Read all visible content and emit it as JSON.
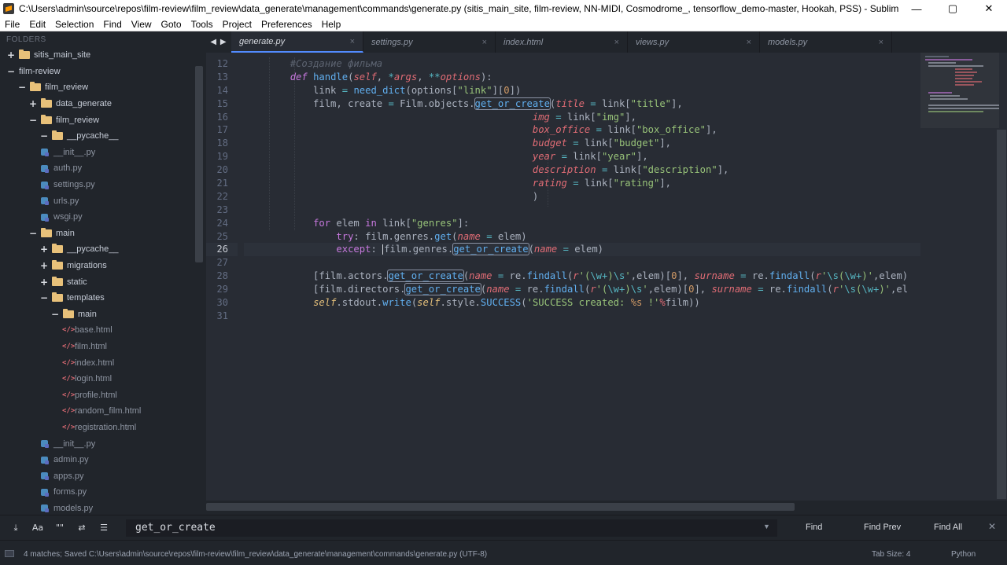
{
  "window": {
    "title": "C:\\Users\\admin\\source\\repos\\film-review\\film_review\\data_generate\\management\\commands\\generate.py (sitis_main_site, film-review, NN-MIDI, Cosmodrome_, tensorflow_demo-master, Hookah, PSS) - Sublime Text",
    "minimize": "—",
    "maximize": "▢",
    "close": "✕"
  },
  "menu": [
    "File",
    "Edit",
    "Selection",
    "Find",
    "View",
    "Goto",
    "Tools",
    "Project",
    "Preferences",
    "Help"
  ],
  "sidebar": {
    "header": "FOLDERS",
    "items": [
      {
        "depth": 0,
        "type": "folder",
        "ctrl": "+",
        "label": "sitis_main_site"
      },
      {
        "depth": 0,
        "type": "root",
        "ctrl": "−",
        "label": "film-review"
      },
      {
        "depth": 1,
        "type": "folder",
        "ctrl": "−",
        "label": "film_review"
      },
      {
        "depth": 2,
        "type": "folder",
        "ctrl": "+",
        "label": "data_generate"
      },
      {
        "depth": 2,
        "type": "folder",
        "ctrl": "−",
        "label": "film_review"
      },
      {
        "depth": 3,
        "type": "folder",
        "ctrl": "−",
        "label": "__pycache__"
      },
      {
        "depth": 3,
        "type": "py",
        "label": "__init__.py"
      },
      {
        "depth": 3,
        "type": "py",
        "label": "auth.py"
      },
      {
        "depth": 3,
        "type": "py",
        "label": "settings.py"
      },
      {
        "depth": 3,
        "type": "py",
        "label": "urls.py"
      },
      {
        "depth": 3,
        "type": "py",
        "label": "wsgi.py"
      },
      {
        "depth": 2,
        "type": "folder",
        "ctrl": "−",
        "label": "main"
      },
      {
        "depth": 3,
        "type": "folder",
        "ctrl": "+",
        "label": "__pycache__"
      },
      {
        "depth": 3,
        "type": "folder",
        "ctrl": "+",
        "label": "migrations"
      },
      {
        "depth": 3,
        "type": "folder",
        "ctrl": "+",
        "label": "static"
      },
      {
        "depth": 3,
        "type": "folder",
        "ctrl": "−",
        "label": "templates"
      },
      {
        "depth": 4,
        "type": "folder",
        "ctrl": "−",
        "label": "main"
      },
      {
        "depth": 5,
        "type": "html",
        "label": "base.html"
      },
      {
        "depth": 5,
        "type": "html",
        "label": "film.html"
      },
      {
        "depth": 5,
        "type": "html",
        "label": "index.html"
      },
      {
        "depth": 5,
        "type": "html",
        "label": "login.html"
      },
      {
        "depth": 5,
        "type": "html",
        "label": "profile.html"
      },
      {
        "depth": 5,
        "type": "html",
        "label": "random_film.html"
      },
      {
        "depth": 5,
        "type": "html",
        "label": "registration.html"
      },
      {
        "depth": 3,
        "type": "py",
        "label": "__init__.py"
      },
      {
        "depth": 3,
        "type": "py",
        "label": "admin.py"
      },
      {
        "depth": 3,
        "type": "py",
        "label": "apps.py"
      },
      {
        "depth": 3,
        "type": "py",
        "label": "forms.py"
      },
      {
        "depth": 3,
        "type": "py",
        "label": "models.py"
      }
    ]
  },
  "tabs": {
    "nav": "◀ ▶",
    "items": [
      {
        "label": "generate.py",
        "active": true
      },
      {
        "label": "settings.py",
        "active": false
      },
      {
        "label": "index.html",
        "active": false
      },
      {
        "label": "views.py",
        "active": false
      },
      {
        "label": "models.py",
        "active": false
      }
    ]
  },
  "editor": {
    "active_line": 26,
    "lines": [
      {
        "n": "12",
        "tokens": [
          [
            "",
            "        "
          ],
          [
            "cm",
            "#Создание фильма"
          ]
        ]
      },
      {
        "n": "13",
        "tokens": [
          [
            "",
            "        "
          ],
          [
            "ki",
            "def"
          ],
          [
            "",
            " "
          ],
          [
            "fn",
            "handle"
          ],
          [
            "",
            "("
          ],
          [
            "par",
            "self"
          ],
          [
            "",
            ", "
          ],
          [
            "op",
            "*"
          ],
          [
            "par",
            "args"
          ],
          [
            "",
            ", "
          ],
          [
            "op",
            "**"
          ],
          [
            "par",
            "options"
          ],
          [
            "",
            "):"
          ]
        ]
      },
      {
        "n": "14",
        "tokens": [
          [
            "",
            "            link "
          ],
          [
            "op",
            "="
          ],
          [
            "",
            " "
          ],
          [
            "fn",
            "need_dict"
          ],
          [
            "",
            "(options["
          ],
          [
            "str",
            "\"link\""
          ],
          [
            "",
            "]["
          ],
          [
            "num",
            "0"
          ],
          [
            "",
            "])"
          ]
        ]
      },
      {
        "n": "15",
        "tokens": [
          [
            "",
            "            film, create "
          ],
          [
            "op",
            "="
          ],
          [
            "",
            " Film.objects."
          ],
          [
            "hl",
            "get_or_create"
          ],
          [
            "",
            "("
          ],
          [
            "par",
            "title"
          ],
          [
            "",
            " "
          ],
          [
            "op",
            "="
          ],
          [
            "",
            " link["
          ],
          [
            "str",
            "\"title\""
          ],
          [
            "",
            "],"
          ]
        ]
      },
      {
        "n": "16",
        "tokens": [
          [
            "",
            "                                                  "
          ],
          [
            "par",
            "img"
          ],
          [
            "",
            " "
          ],
          [
            "op",
            "="
          ],
          [
            "",
            " link["
          ],
          [
            "str",
            "\"img\""
          ],
          [
            "",
            "],"
          ]
        ]
      },
      {
        "n": "17",
        "tokens": [
          [
            "",
            "                                                  "
          ],
          [
            "par",
            "box_office"
          ],
          [
            "",
            " "
          ],
          [
            "op",
            "="
          ],
          [
            "",
            " link["
          ],
          [
            "str",
            "\"box_office\""
          ],
          [
            "",
            "],"
          ]
        ]
      },
      {
        "n": "18",
        "tokens": [
          [
            "",
            "                                                  "
          ],
          [
            "par",
            "budget"
          ],
          [
            "",
            " "
          ],
          [
            "op",
            "="
          ],
          [
            "",
            " link["
          ],
          [
            "str",
            "\"budget\""
          ],
          [
            "",
            "],"
          ]
        ]
      },
      {
        "n": "19",
        "tokens": [
          [
            "",
            "                                                  "
          ],
          [
            "par",
            "year"
          ],
          [
            "",
            " "
          ],
          [
            "op",
            "="
          ],
          [
            "",
            " link["
          ],
          [
            "str",
            "\"year\""
          ],
          [
            "",
            "],"
          ]
        ]
      },
      {
        "n": "20",
        "tokens": [
          [
            "",
            "                                                  "
          ],
          [
            "par",
            "description"
          ],
          [
            "",
            " "
          ],
          [
            "op",
            "="
          ],
          [
            "",
            " link["
          ],
          [
            "str",
            "\"description\""
          ],
          [
            "",
            "],"
          ]
        ]
      },
      {
        "n": "21",
        "tokens": [
          [
            "",
            "                                                  "
          ],
          [
            "par",
            "rating"
          ],
          [
            "",
            " "
          ],
          [
            "op",
            "="
          ],
          [
            "",
            " link["
          ],
          [
            "str",
            "\"rating\""
          ],
          [
            "",
            "],"
          ]
        ]
      },
      {
        "n": "22",
        "tokens": [
          [
            "",
            "                                                  )"
          ]
        ]
      },
      {
        "n": "23",
        "tokens": [
          [
            "",
            ""
          ]
        ]
      },
      {
        "n": "24",
        "tokens": [
          [
            "",
            "            "
          ],
          [
            "kw",
            "for"
          ],
          [
            "",
            " elem "
          ],
          [
            "kw",
            "in"
          ],
          [
            "",
            " link["
          ],
          [
            "str",
            "\"genres\""
          ],
          [
            "",
            "]:"
          ]
        ]
      },
      {
        "n": "25",
        "tokens": [
          [
            "",
            "                "
          ],
          [
            "kw",
            "try"
          ],
          [
            "",
            ": film.genres."
          ],
          [
            "fn",
            "get"
          ],
          [
            "",
            "("
          ],
          [
            "par",
            "name"
          ],
          [
            "",
            " "
          ],
          [
            "op",
            "="
          ],
          [
            "",
            " elem)"
          ]
        ]
      },
      {
        "n": "26",
        "tokens": [
          [
            "",
            "                "
          ],
          [
            "kw",
            "except"
          ],
          [
            "",
            ": "
          ],
          [
            "caret",
            ""
          ],
          [
            "",
            "film.genres."
          ],
          [
            "hl",
            "get_or_create"
          ],
          [
            "",
            "("
          ],
          [
            "par",
            "name"
          ],
          [
            "",
            " "
          ],
          [
            "op",
            "="
          ],
          [
            "",
            " elem)"
          ]
        ]
      },
      {
        "n": "27",
        "tokens": [
          [
            "",
            ""
          ]
        ]
      },
      {
        "n": "28",
        "tokens": [
          [
            "",
            "            [film.actors."
          ],
          [
            "hl",
            "get_or_create"
          ],
          [
            "",
            "("
          ],
          [
            "par",
            "name"
          ],
          [
            "",
            " "
          ],
          [
            "op",
            "="
          ],
          [
            "",
            " re."
          ],
          [
            "fn",
            "findall"
          ],
          [
            "",
            "("
          ],
          [
            "par",
            "r"
          ],
          [
            "str",
            "'("
          ],
          [
            "op",
            "\\w+"
          ],
          [
            "str",
            ")"
          ],
          [
            "op",
            "\\s"
          ],
          [
            "str",
            "'"
          ],
          [
            "",
            ",elem)["
          ],
          [
            "num",
            "0"
          ],
          [
            "",
            "], "
          ],
          [
            "par",
            "surname"
          ],
          [
            "",
            " "
          ],
          [
            "op",
            "="
          ],
          [
            "",
            " re."
          ],
          [
            "fn",
            "findall"
          ],
          [
            "",
            "("
          ],
          [
            "par",
            "r"
          ],
          [
            "str",
            "'"
          ],
          [
            "op",
            "\\s"
          ],
          [
            "str",
            "("
          ],
          [
            "op",
            "\\w+"
          ],
          [
            "str",
            ")'"
          ],
          [
            "",
            ",elem)"
          ]
        ]
      },
      {
        "n": "29",
        "tokens": [
          [
            "",
            "            [film.directors."
          ],
          [
            "hl",
            "get_or_create"
          ],
          [
            "",
            "("
          ],
          [
            "par",
            "name"
          ],
          [
            "",
            " "
          ],
          [
            "op",
            "="
          ],
          [
            "",
            " re."
          ],
          [
            "fn",
            "findall"
          ],
          [
            "",
            "("
          ],
          [
            "par",
            "r"
          ],
          [
            "str",
            "'("
          ],
          [
            "op",
            "\\w+"
          ],
          [
            "str",
            ")"
          ],
          [
            "op",
            "\\s"
          ],
          [
            "str",
            "'"
          ],
          [
            "",
            ",elem)["
          ],
          [
            "num",
            "0"
          ],
          [
            "",
            "], "
          ],
          [
            "par",
            "surname"
          ],
          [
            "",
            " "
          ],
          [
            "op",
            "="
          ],
          [
            "",
            " re."
          ],
          [
            "fn",
            "findall"
          ],
          [
            "",
            "("
          ],
          [
            "par",
            "r"
          ],
          [
            "str",
            "'"
          ],
          [
            "op",
            "\\s"
          ],
          [
            "str",
            "("
          ],
          [
            "op",
            "\\w+"
          ],
          [
            "str",
            ")'"
          ],
          [
            "",
            ",el"
          ]
        ]
      },
      {
        "n": "30",
        "tokens": [
          [
            "",
            "            "
          ],
          [
            "self",
            "self"
          ],
          [
            "",
            ".stdout."
          ],
          [
            "fn",
            "write"
          ],
          [
            "",
            "("
          ],
          [
            "self",
            "self"
          ],
          [
            "",
            ".style."
          ],
          [
            "fn",
            "SUCCESS"
          ],
          [
            "",
            "("
          ],
          [
            "str",
            "'SUCCESS created: "
          ],
          [
            "num",
            "%s"
          ],
          [
            "str",
            " !'"
          ],
          [
            "opk",
            "%"
          ],
          [
            "",
            "film))"
          ]
        ]
      },
      {
        "n": "31",
        "tokens": [
          [
            "",
            ""
          ]
        ]
      }
    ]
  },
  "find": {
    "options": [
      "⤓",
      "Aa",
      "\"\"",
      "⇄",
      "☰"
    ],
    "value": "get_or_create",
    "dropdown": "▼",
    "find_label": "Find",
    "find_prev_label": "Find Prev",
    "find_all_label": "Find All",
    "close": "✕"
  },
  "status": {
    "message": "4 matches; Saved C:\\Users\\admin\\source\\repos\\film-review\\film_review\\data_generate\\management\\commands\\generate.py (UTF-8)",
    "tab_size": "Tab Size: 4",
    "syntax": "Python"
  },
  "colors": {
    "background": "#282c34",
    "sidebar": "#21252b",
    "accent": "#528bff",
    "folder": "#e8c17a"
  }
}
